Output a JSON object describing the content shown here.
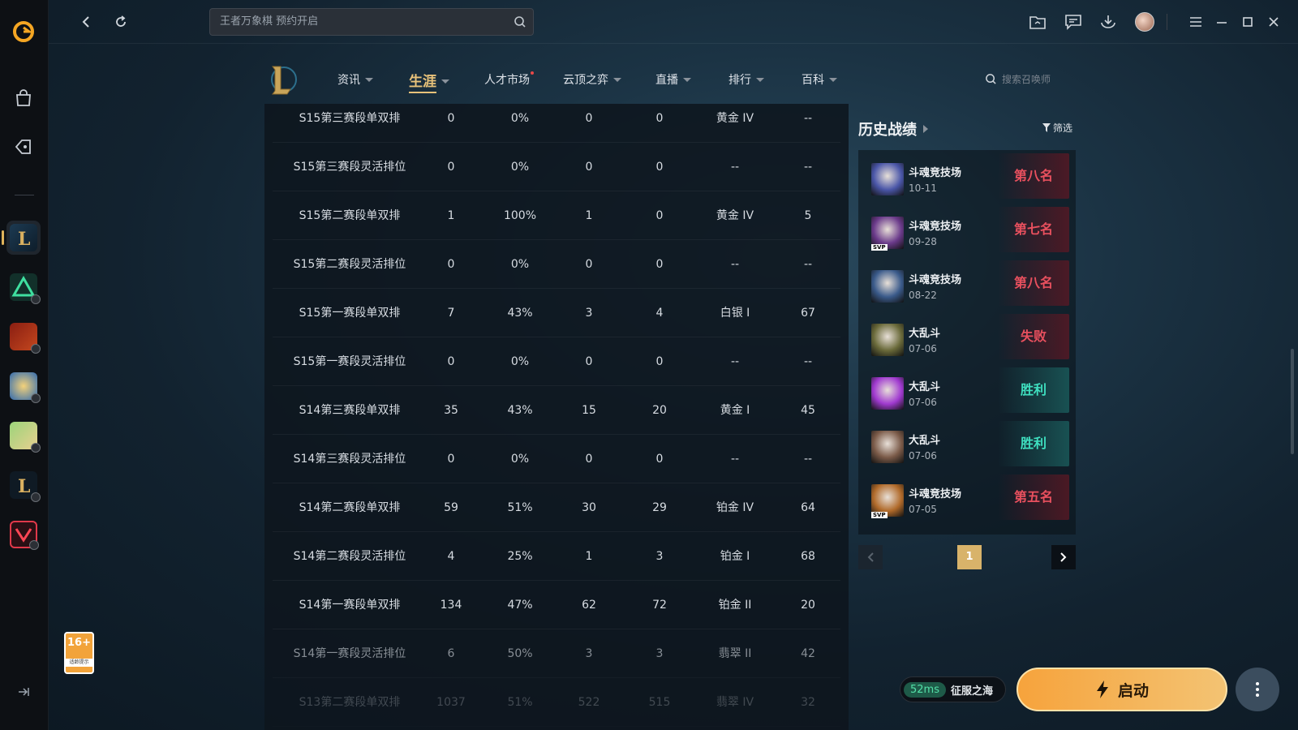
{
  "search": {
    "placeholder": "王者万象棋 预约开启"
  },
  "sidebar": {
    "age_rating": "16+",
    "age_note": "适龄提示"
  },
  "nav": {
    "items": [
      {
        "label": "资讯",
        "caret": true
      },
      {
        "label": "生涯",
        "caret": true,
        "active": true
      },
      {
        "label": "人才市场",
        "caret": false,
        "dot": true
      },
      {
        "label": "云顶之弈",
        "caret": true
      },
      {
        "label": "直播",
        "caret": true
      },
      {
        "label": "排行",
        "caret": true
      },
      {
        "label": "百科",
        "caret": true
      }
    ],
    "summoner_search_placeholder": "搜索召唤师"
  },
  "career_table": {
    "rows": [
      [
        "S15第三赛段单双排",
        "0",
        "0%",
        "0",
        "0",
        "黄金 IV",
        "--"
      ],
      [
        "S15第三赛段灵活排位",
        "0",
        "0%",
        "0",
        "0",
        "--",
        "--"
      ],
      [
        "S15第二赛段单双排",
        "1",
        "100%",
        "1",
        "0",
        "黄金 IV",
        "5"
      ],
      [
        "S15第二赛段灵活排位",
        "0",
        "0%",
        "0",
        "0",
        "--",
        "--"
      ],
      [
        "S15第一赛段单双排",
        "7",
        "43%",
        "3",
        "4",
        "白银 I",
        "67"
      ],
      [
        "S15第一赛段灵活排位",
        "0",
        "0%",
        "0",
        "0",
        "--",
        "--"
      ],
      [
        "S14第三赛段单双排",
        "35",
        "43%",
        "15",
        "20",
        "黄金 I",
        "45"
      ],
      [
        "S14第三赛段灵活排位",
        "0",
        "0%",
        "0",
        "0",
        "--",
        "--"
      ],
      [
        "S14第二赛段单双排",
        "59",
        "51%",
        "30",
        "29",
        "铂金 IV",
        "64"
      ],
      [
        "S14第二赛段灵活排位",
        "4",
        "25%",
        "1",
        "3",
        "铂金 I",
        "68"
      ],
      [
        "S14第一赛段单双排",
        "134",
        "47%",
        "62",
        "72",
        "铂金 II",
        "20"
      ],
      [
        "S14第一赛段灵活排位",
        "6",
        "50%",
        "3",
        "3",
        "翡翠 II",
        "42"
      ],
      [
        "S13第二赛段单双排",
        "1037",
        "51%",
        "522",
        "515",
        "翡翠 IV",
        "32"
      ]
    ]
  },
  "history": {
    "title": "历史战绩",
    "filter_label": "筛选",
    "matches": [
      {
        "mode": "斗魂竞技场",
        "date": "10-11",
        "result": "第八名",
        "outcome": "lose",
        "svp": false,
        "hero_color": "#4a56a8"
      },
      {
        "mode": "斗魂竞技场",
        "date": "09-28",
        "result": "第七名",
        "outcome": "lose",
        "svp": true,
        "hero_color": "#6a3a8a"
      },
      {
        "mode": "斗魂竞技场",
        "date": "08-22",
        "result": "第八名",
        "outcome": "lose",
        "svp": false,
        "hero_color": "#3a5a8a"
      },
      {
        "mode": "大乱斗",
        "date": "07-06",
        "result": "失败",
        "outcome": "lose",
        "svp": false,
        "hero_color": "#6a6a3a"
      },
      {
        "mode": "大乱斗",
        "date": "07-06",
        "result": "胜利",
        "outcome": "win",
        "svp": false,
        "hero_color": "#a03ad0"
      },
      {
        "mode": "大乱斗",
        "date": "07-06",
        "result": "胜利",
        "outcome": "win",
        "svp": false,
        "hero_color": "#7a5a48"
      },
      {
        "mode": "斗魂竞技场",
        "date": "07-05",
        "result": "第五名",
        "outcome": "lose",
        "svp": true,
        "hero_color": "#b06a2a"
      }
    ],
    "page": "1"
  },
  "footer": {
    "ping": "52ms",
    "server": "征服之海",
    "launch_label": "启动"
  }
}
